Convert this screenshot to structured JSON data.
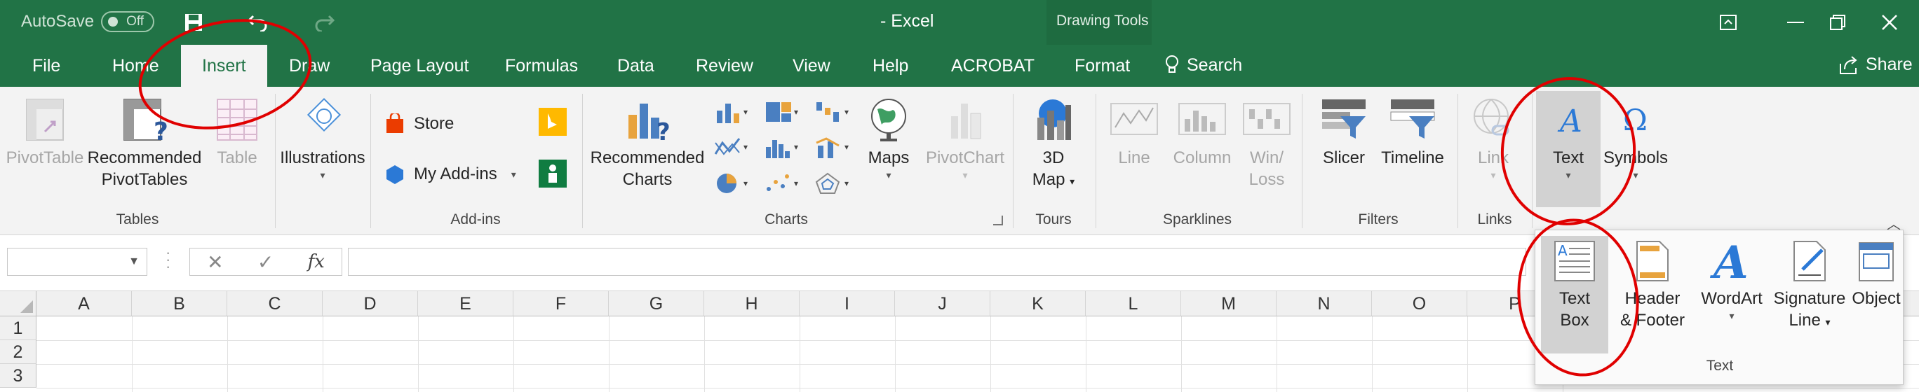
{
  "titlebar": {
    "autosave_label": "AutoSave",
    "autosave_state": "Off",
    "title": "- Excel",
    "context_tab_group": "Drawing Tools",
    "icons": [
      "save-icon",
      "undo-icon",
      "redo-icon",
      "ribbon-display-icon",
      "restore-icon",
      "close-icon"
    ]
  },
  "tabs": {
    "items": [
      "File",
      "Home",
      "Insert",
      "Draw",
      "Page Layout",
      "Formulas",
      "Data",
      "Review",
      "View",
      "Help",
      "ACROBAT",
      "Format"
    ],
    "active": "Insert",
    "search": "Search",
    "share": "Share"
  },
  "ribbon": {
    "tables": {
      "pivottable": "PivotTable",
      "recommended_line1": "Recommended",
      "recommended_line2": "PivotTables",
      "table": "Table",
      "label": "Tables"
    },
    "illustrations": {
      "label_btn": "Illustrations"
    },
    "addins": {
      "store": "Store",
      "my_addins": "My Add-ins",
      "label": "Add-ins"
    },
    "charts": {
      "recommended_line1": "Recommended",
      "recommended_line2": "Charts",
      "maps": "Maps",
      "pivotchart": "PivotChart",
      "label": "Charts"
    },
    "tours": {
      "map_line1": "3D",
      "map_line2": "Map",
      "label": "Tours"
    },
    "sparklines": {
      "line": "Line",
      "column": "Column",
      "winloss_line1": "Win/",
      "winloss_line2": "Loss",
      "label": "Sparklines"
    },
    "filters": {
      "slicer": "Slicer",
      "timeline": "Timeline",
      "label": "Filters"
    },
    "links": {
      "link": "Link",
      "label": "Links"
    },
    "text": {
      "label_btn": "Text"
    },
    "symbols": {
      "label_btn": "Symbols"
    }
  },
  "columns": [
    "A",
    "B",
    "C",
    "D",
    "E",
    "F",
    "G",
    "H",
    "I",
    "J",
    "K",
    "L",
    "M",
    "N",
    "O",
    "P"
  ],
  "rows": [
    "1",
    "2",
    "3"
  ],
  "text_panel": {
    "textbox_line1": "Text",
    "textbox_line2": "Box",
    "header_line1": "Header",
    "header_line2": "& Footer",
    "wordart": "WordArt",
    "signature_line1": "Signature",
    "signature_line2": "Line",
    "object": "Object",
    "group_label": "Text"
  },
  "colors": {
    "excel_green": "#217346",
    "annotation_red": "#e00000",
    "selected_gray": "#d2d2d2"
  }
}
